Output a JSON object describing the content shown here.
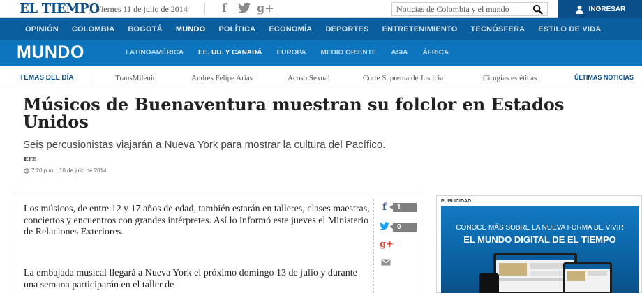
{
  "header": {
    "logo": "EL TIEMPO",
    "date": "Viernes 11 de julio de 2014",
    "social": {
      "facebook": "f",
      "twitter": "twitter-bird",
      "googleplus": "g+"
    },
    "search_placeholder": "Noticias de Colombia y el mundo",
    "login_label": "INGRESAR"
  },
  "nav": {
    "items": [
      "OPINIÓN",
      "COLOMBIA",
      "BOGOTÁ",
      "MUNDO",
      "POLÍTICA",
      "ECONOMÍA",
      "DEPORTES",
      "ENTRETENIMIENTO",
      "TECNÓSFERA",
      "ESTILO DE VIDA"
    ],
    "active": "MUNDO"
  },
  "section": {
    "title": "MUNDO",
    "subnav": [
      "LATINOAMÉRICA",
      "EE. UU. Y CANADÁ",
      "EUROPA",
      "MEDIO ORIENTE",
      "ASIA",
      "ÁFRICA"
    ],
    "active": "EE. UU. Y CANADÁ"
  },
  "topics": {
    "label": "TEMAS DEL DÍA",
    "items": [
      "TransMilenio",
      "Andres Felipe Arias",
      "Acoso Sexual",
      "Corte Suprema de Justicia",
      "Cirugías estéticas"
    ],
    "latest_link": "ÚLTIMAS NOTICIAS"
  },
  "article": {
    "headline": "Músicos de Buenaventura muestran su folclor en Estados Unidos",
    "subhead": "Seis percusionistas viajarán a Nueva York para mostrar la cultura del Pacífico.",
    "byline": "EFE",
    "timestamp": "7:20 p.m. | 10 de julio de 2014",
    "paragraphs": [
      "Los músicos, de entre 12 y 17 años de edad, también estarán en talleres, clases maestras, conciertos y encuentros con grandes intérpretes. Así lo informó este jueves el Ministerio de Relaciones Exteriores.",
      "La embajada musical llegará a Nueva York el próximo domingo 13 de julio y durante una semana participarán en el taller de"
    ],
    "share": {
      "facebook_count": "1",
      "twitter_count": "0",
      "googleplus": "g+"
    }
  },
  "ad": {
    "label": "PUBLICIDAD",
    "line1": "CONOCE MÁS SOBRE LA NUEVA FORMA DE VIVIR",
    "line2": "EL MUNDO DIGITAL DE EL TIEMPO"
  },
  "colors": {
    "brand": "#0a4f8a",
    "nav_bg": "#0a5e9e",
    "section_bg": "#0d75bd",
    "facebook": "#3b5998",
    "twitter": "#1da1f2",
    "googleplus": "#dd4b39"
  }
}
